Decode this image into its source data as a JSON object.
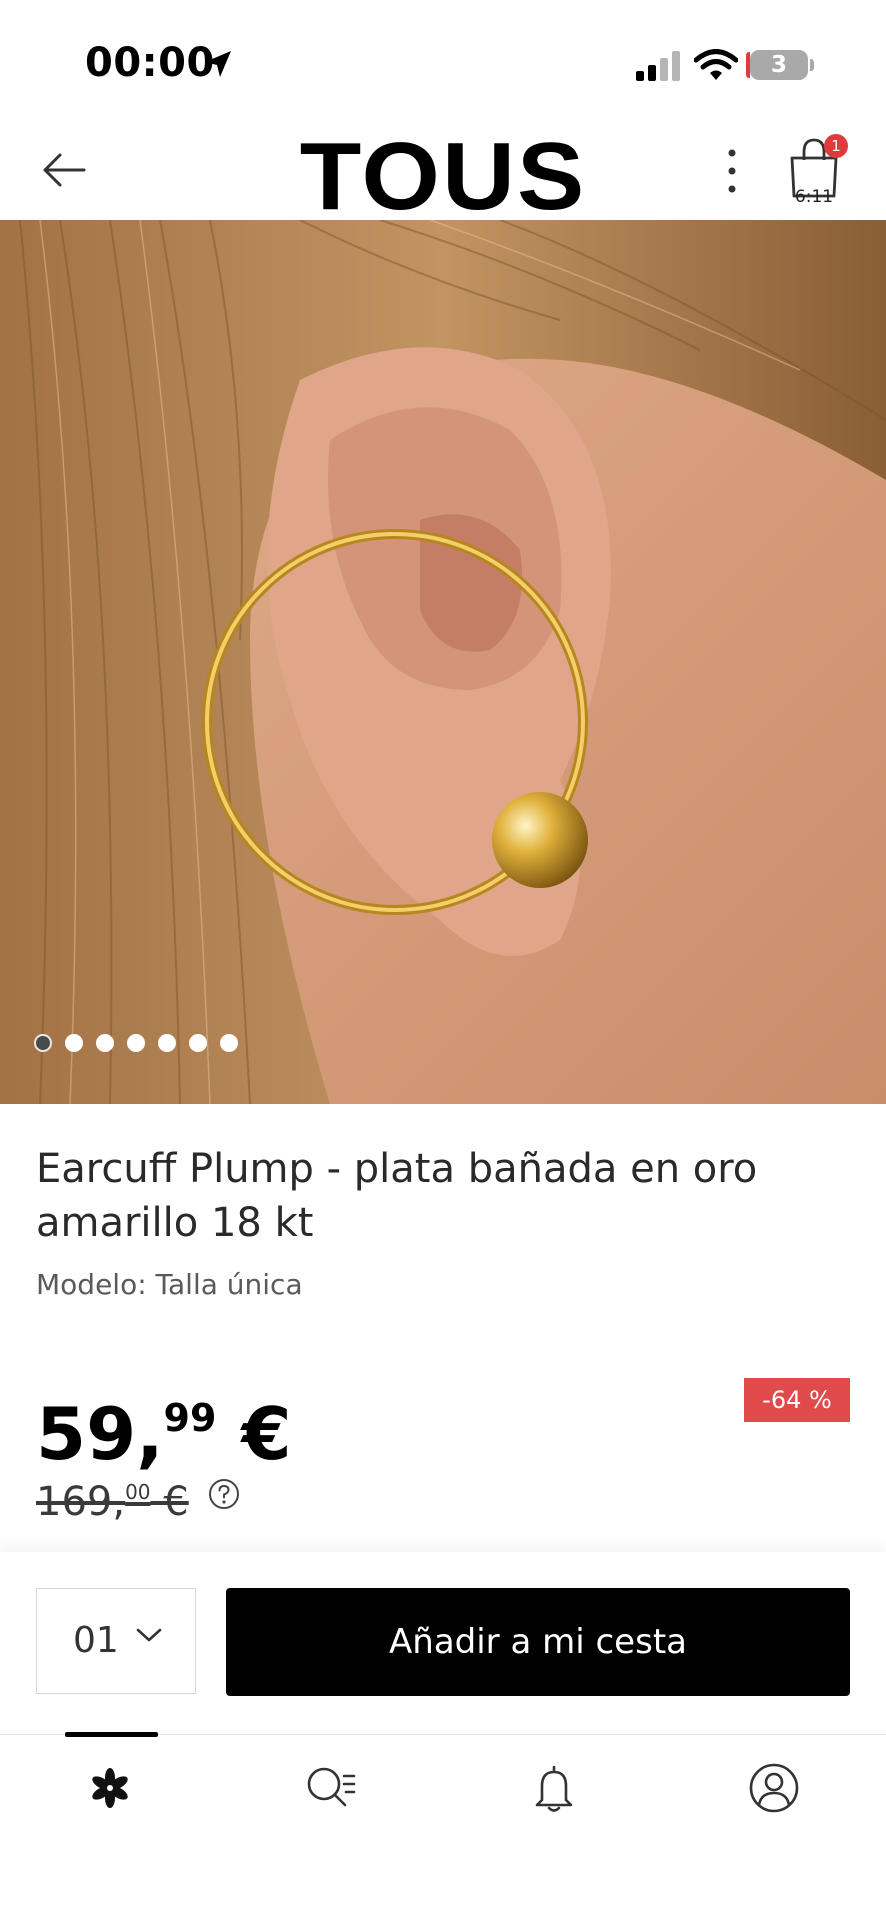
{
  "status_bar": {
    "time": "00:00",
    "battery_level": "3",
    "icons": [
      "location-arrow-icon",
      "signal-icon",
      "wifi-icon",
      "battery-icon"
    ]
  },
  "header": {
    "brand": "TOUS",
    "cart_badge_count": "1",
    "cart_caption": "6:11",
    "icons": [
      "back-arrow-icon",
      "more-vertical-icon",
      "shopping-bag-icon"
    ]
  },
  "gallery": {
    "image_count": 7,
    "active_index": 0
  },
  "product": {
    "title": "Earcuff Plump - plata bañada en oro amarillo 18 kt",
    "model": "Modelo: Talla única",
    "price": {
      "main": "59,",
      "cents": "99",
      "currency": " €"
    },
    "old_price": {
      "main": "169,",
      "cents": "00",
      "currency": " €"
    },
    "discount": "-64 %"
  },
  "actions": {
    "quantity": "01",
    "add_to_cart_label": "Añadir a mi cesta"
  },
  "tabbar": {
    "tabs": [
      "home-flower-icon",
      "search-list-icon",
      "bell-icon",
      "user-icon"
    ],
    "active": 0
  },
  "colors": {
    "accent_red": "#e04a4a",
    "button_black": "#000000",
    "gold": "#d9a92f"
  }
}
